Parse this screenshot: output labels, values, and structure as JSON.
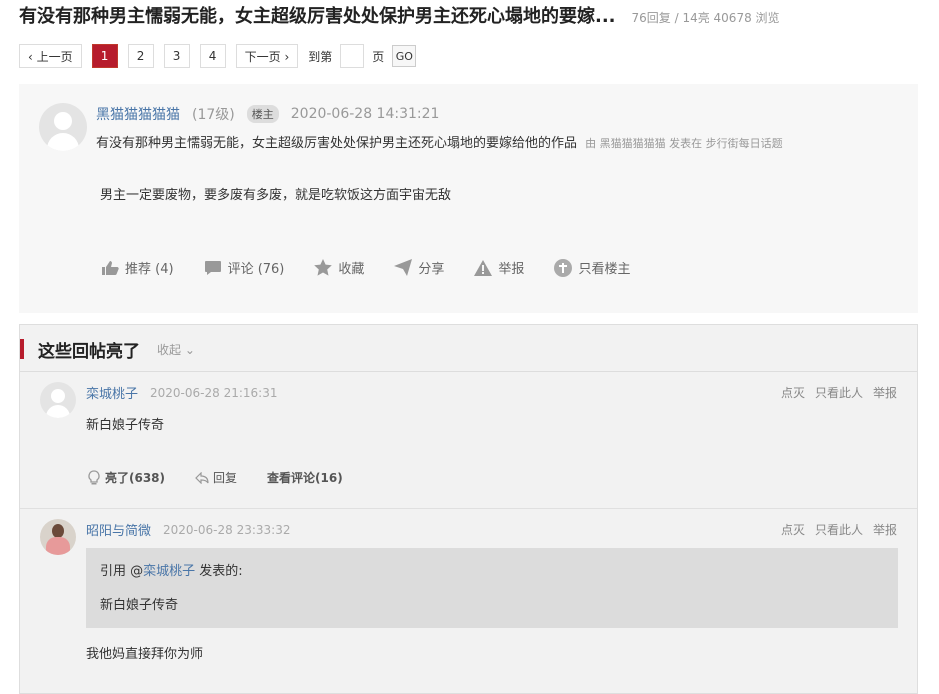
{
  "thread": {
    "title": "有没有那种男主懦弱无能，女主超级厉害处处保护男主还死心塌地的要嫁...",
    "meta": "76回复 / 14亮 40678 浏览"
  },
  "pager": {
    "prev": "‹ 上一页",
    "pages": [
      "1",
      "2",
      "3",
      "4"
    ],
    "next": "下一页 ›",
    "goto_prefix": "到第",
    "goto_suffix": "页",
    "go": "GO"
  },
  "main_post": {
    "username": "黑猫猫猫猫猫",
    "level": "(17级)",
    "badge": "楼主",
    "time": "2020-06-28 14:31:21",
    "subject": "有没有那种男主懦弱无能，女主超级厉害处处保护男主还死心塌地的要嫁给他的作品",
    "from": "由 黑猫猫猫猫猫 发表在 步行街每日话题",
    "body": "男主一定要废物，要多废有多废，就是吃软饭这方面宇宙无敌",
    "actions": {
      "recommend": "推荐 (4)",
      "comment": "评论 (76)",
      "favorite": "收藏",
      "share": "分享",
      "report": "举报",
      "owner_only": "只看楼主"
    }
  },
  "highlights": {
    "title": "这些回帖亮了",
    "collapse": "收起",
    "replies": [
      {
        "username": "栾城桃子",
        "time": "2020-06-28 21:16:31",
        "links": [
          "点灭",
          "只看此人",
          "举报"
        ],
        "text": "新白娘子传奇",
        "light": "亮了(638)",
        "reply": "回复",
        "view_comments": "查看评论(16)"
      },
      {
        "username": "昭阳与简微",
        "time": "2020-06-28 23:33:32",
        "links": [
          "点灭",
          "只看此人",
          "举报"
        ],
        "quote_prefix": "引用 @",
        "quote_user": "栾城桃子",
        "quote_suffix": " 发表的:",
        "quote_text": "新白娘子传奇",
        "text": "我他妈直接拜你为师"
      }
    ]
  }
}
